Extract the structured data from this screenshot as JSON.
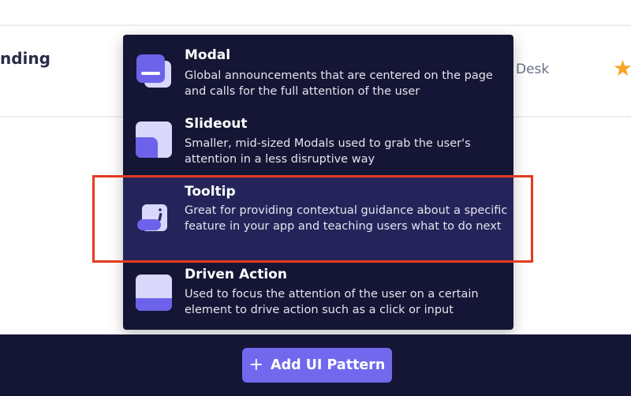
{
  "background": {
    "left_text": "nding",
    "right_text": "Desk"
  },
  "menu": {
    "items": [
      {
        "title": "Modal",
        "description": "Global announcements that are centered on the page and calls for the full attention of the user",
        "icon": "modal-icon"
      },
      {
        "title": "Slideout",
        "description": "Smaller, mid-sized Modals used to grab the user's attention in a less disruptive way",
        "icon": "slideout-icon"
      },
      {
        "title": "Tooltip",
        "description": "Great for providing contextual guidance about a specific feature in your app and teaching users what to do next",
        "icon": "tooltip-icon",
        "highlighted": true
      },
      {
        "title": "Driven Action",
        "description": "Used to focus the attention of the user on a certain element to drive action such as a click or input",
        "icon": "driven-action-icon"
      }
    ]
  },
  "footer": {
    "add_button_label": "Add UI Pattern",
    "add_button_icon": "plus-icon"
  },
  "colors": {
    "menu_bg": "#151635",
    "highlight_bg": "#25245a",
    "accent": "#7168ee",
    "highlight_frame": "#e43a20",
    "star": "#f5a524"
  }
}
